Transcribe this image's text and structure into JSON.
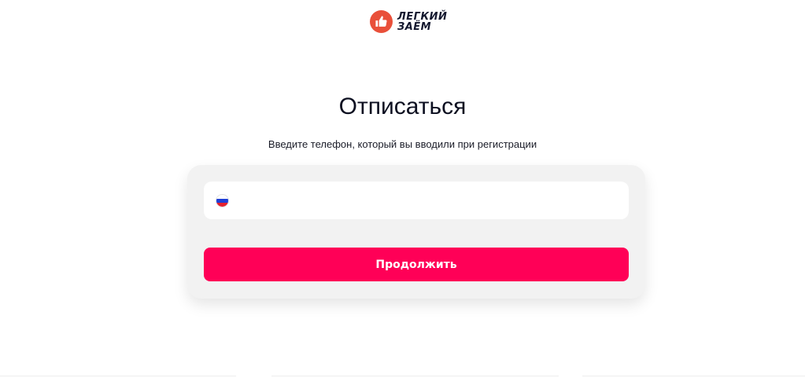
{
  "logo": {
    "line1": "ЛЕГКИЙ",
    "line2": "ЗАЁМ",
    "icon": "thumbs-up-icon",
    "color": "#e9503a"
  },
  "title": "Отписаться",
  "subtitle": "Введите телефон, который вы вводили при регистрации",
  "form": {
    "country_flag": "russia-flag-icon",
    "phone_value": "",
    "submit_label": "Продолжить",
    "accent_color": "#ff0057"
  }
}
